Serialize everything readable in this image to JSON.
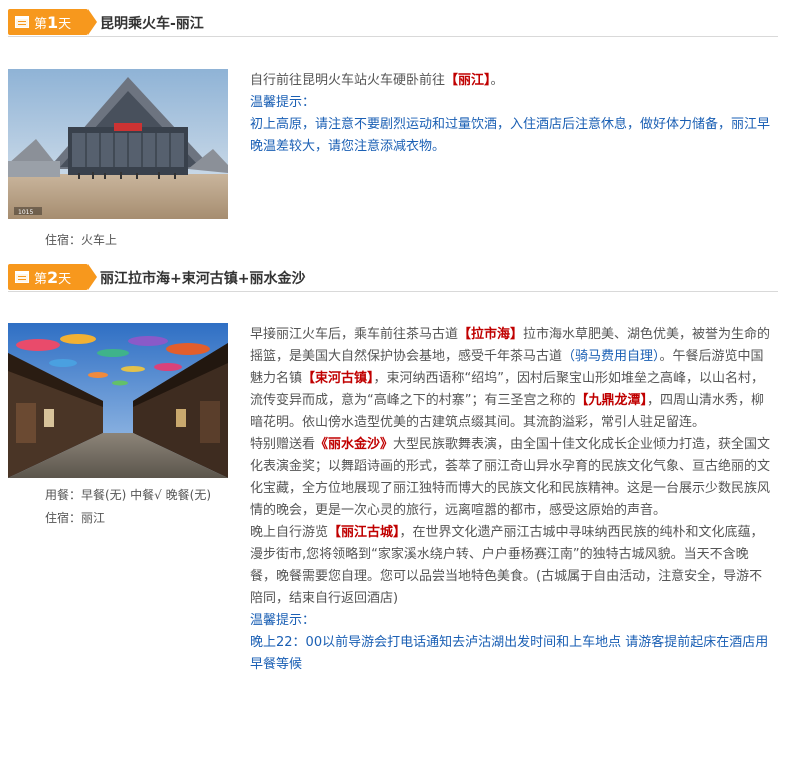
{
  "days": [
    {
      "badge_prefix": "第",
      "badge_num": "1",
      "badge_suffix": "天",
      "title": "昆明乘火车-丽江",
      "lodging": "住宿：火车上",
      "desc": {
        "line1_a": "自行前往昆明火车站火车硬卧前往",
        "line1_hl": "【丽江】",
        "line1_b": "。",
        "tip_label": "温馨提示：",
        "tip_text": "初上高原，请注意不要剧烈运动和过量饮酒，入住酒店后注意休息，做好体力储备，丽江早晚温差较大，请您注意添减衣物。"
      }
    },
    {
      "badge_prefix": "第",
      "badge_num": "2",
      "badge_suffix": "天",
      "title": "丽江拉市海+束河古镇+丽水金沙",
      "meals": "用餐：早餐(无)  中餐√  晚餐(无)",
      "lodging": "住宿：丽江",
      "desc": {
        "p1_a": "早接丽江火车后，乘车前往茶马古道",
        "p1_hl1": "【拉市海】",
        "p1_b": "拉市海水草肥美、湖色优美，被誉为生命的摇篮，是美国大自然保护协会基地，感受千年茶马古道",
        "p1_blue": "（骑马费用自理）",
        "p1_c": "。午餐后游览中国魅力名镇",
        "p1_hl2": "【束河古镇】",
        "p1_d": "，束河纳西语称“绍坞”，因村后聚宝山形如堆垒之高峰，以山名村，流传变异而成，意为“高峰之下的村寨”；有三圣宫之称的",
        "p1_hl3": "【九鼎龙潭】",
        "p1_e": "，四周山清水秀，柳暗花明。依山傍水造型优美的古建筑点缀其间。其流韵溢彩，常引人驻足留连。",
        "p2_a": "特别赠送看",
        "p2_hl": "《丽水金沙》",
        "p2_b": "大型民族歌舞表演，由全国十佳文化成长企业倾力打造，获全国文化表演金奖；以舞蹈诗画的形式，荟萃了丽江奇山异水孕育的民族文化气象、亘古绝丽的文化宝藏，全方位地展现了丽江独特而博大的民族文化和民族精神。这是一台展示少数民族风情的晚会，更是一次心灵的旅行，远离喧嚣的都市，感受这原始的声音。",
        "p3_a": "晚上自行游览",
        "p3_hl": "【丽江古城】",
        "p3_b": "，在世界文化遗产丽江古城中寻味纳西民族的纯朴和文化底蕴，漫步街市,您将领略到“家家溪水绕户转、户户垂杨赛江南”的独特古城风貌。当天不含晚餐，晚餐需要您自理。您可以品尝当地特色美食。(古城属于自由活动，注意安全，导游不陪同，结束自行返回酒店)",
        "tip_label": "温馨提示：",
        "tip_text": "晚上22：00以前导游会打电话通知去泸沽湖出发时间和上车地点 请游客提前起床在酒店用早餐等候"
      }
    }
  ],
  "photo1_caption": "1015"
}
